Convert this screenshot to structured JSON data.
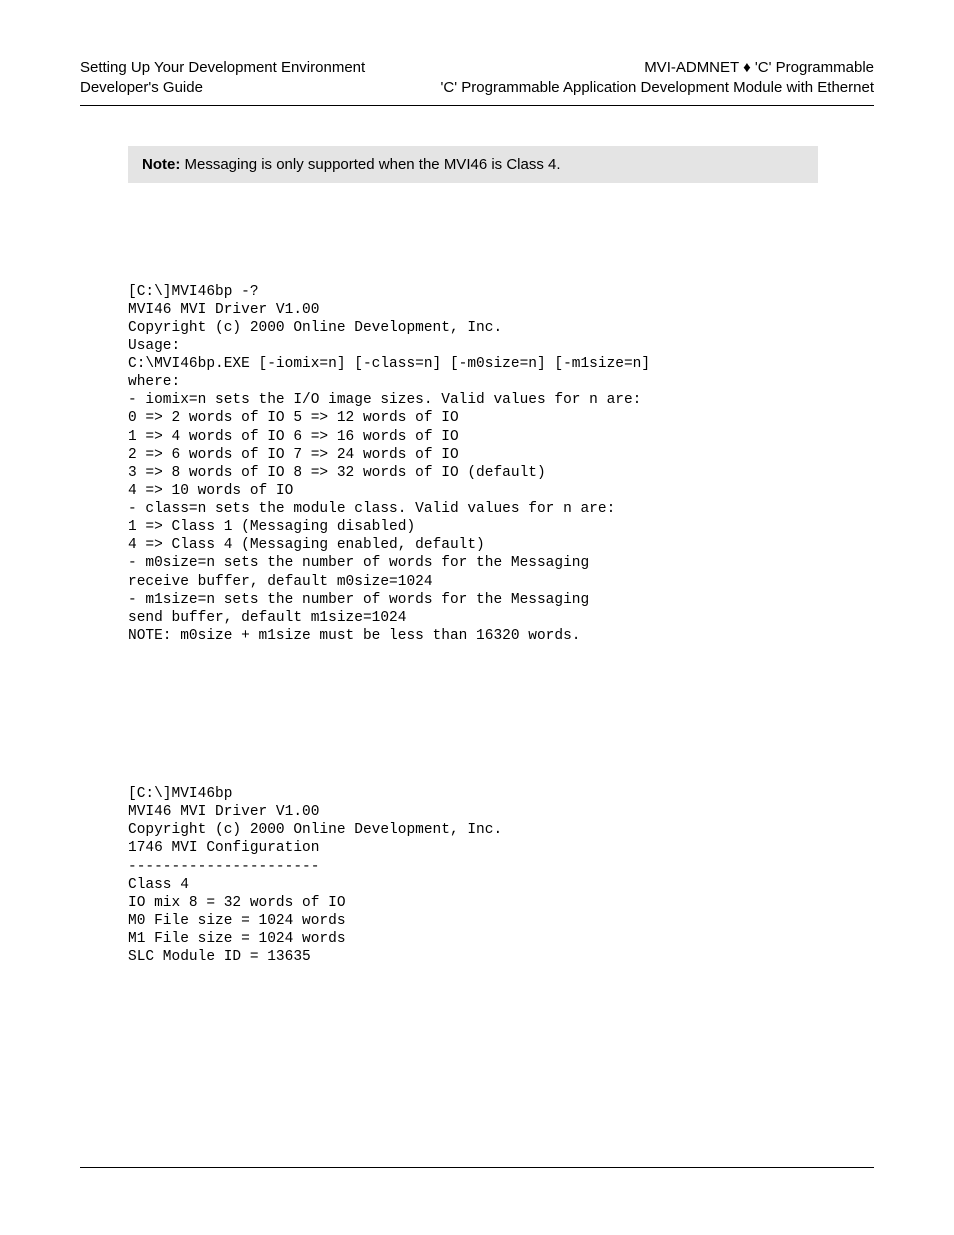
{
  "header": {
    "left_line1": "Setting Up Your Development Environment",
    "left_line2": "Developer's Guide",
    "right_line1": "MVI-ADMNET ♦ 'C' Programmable",
    "right_line2": "'C' Programmable Application Development Module with Ethernet"
  },
  "note": {
    "label": "Note:",
    "text": " Messaging is only supported when the MVI46 is Class 4."
  },
  "code1": "[C:\\]MVI46bp -?\nMVI46 MVI Driver V1.00\nCopyright (c) 2000 Online Development, Inc.\nUsage:\nC:\\MVI46bp.EXE [-iomix=n] [-class=n] [-m0size=n] [-m1size=n]\nwhere:\n- iomix=n sets the I/O image sizes. Valid values for n are:\n0 => 2 words of IO 5 => 12 words of IO\n1 => 4 words of IO 6 => 16 words of IO\n2 => 6 words of IO 7 => 24 words of IO\n3 => 8 words of IO 8 => 32 words of IO (default)\n4 => 10 words of IO\n- class=n sets the module class. Valid values for n are:\n1 => Class 1 (Messaging disabled)\n4 => Class 4 (Messaging enabled, default)\n- m0size=n sets the number of words for the Messaging\nreceive buffer, default m0size=1024\n- m1size=n sets the number of words for the Messaging\nsend buffer, default m1size=1024\nNOTE: m0size + m1size must be less than 16320 words.",
  "code2": "[C:\\]MVI46bp\nMVI46 MVI Driver V1.00\nCopyright (c) 2000 Online Development, Inc.\n1746 MVI Configuration\n----------------------\nClass 4\nIO mix 8 = 32 words of IO\nM0 File size = 1024 words\nM1 File size = 1024 words\nSLC Module ID = 13635"
}
